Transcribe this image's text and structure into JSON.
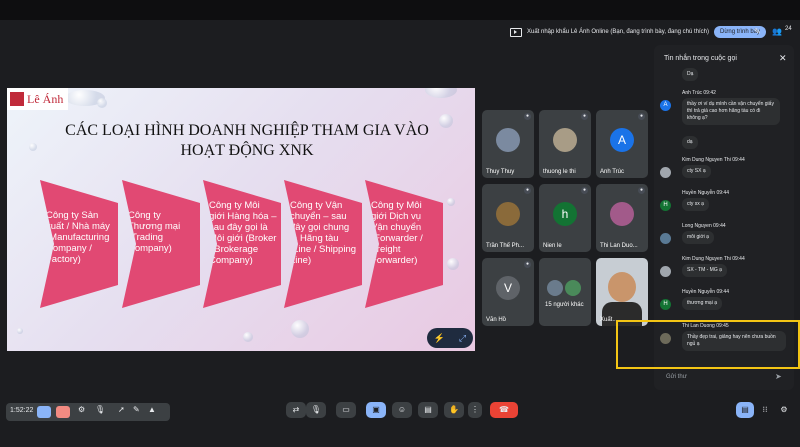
{
  "meeting": {
    "presenting_text": "Xuất nhập khẩu Lê Ánh Online (Bạn, đang trình bày, đang chú thích)",
    "stop_label": "Dừng trình bày",
    "participant_count": "24"
  },
  "slide": {
    "logo_text": "Lê Ánh",
    "title": "CÁC LOẠI HÌNH DOANH NGHIỆP THAM GIA VÀO HOẠT ĐỘNG XNK",
    "items": [
      "Công ty Sản xuất / Nhà máy (Manufacturing Company / Factory)",
      "Công ty Thương mại (Trading Company)",
      "Công ty Môi giới Hàng hóa – sau đây gọi là Môi giới (Broker / Brokerage Company)",
      "Công ty Vận chuyển – sau đây gọi chung là Hãng tàu (Line / Shipping Line)",
      "Công ty Môi giới Dịch vụ Vận chuyển (Forwarder / Freight Forwarder)"
    ]
  },
  "tiles": [
    {
      "name": "Thuy Thuy",
      "bg": "#7b8aa0"
    },
    {
      "name": "thuong le thi",
      "bg": "#a89c86"
    },
    {
      "name": "Anh Trúc",
      "letter": "A",
      "bg": "#1a73e8"
    },
    {
      "name": "Trần Thế Ph...",
      "bg": "#8a6a3a"
    },
    {
      "name": "Nien le",
      "letter": "h",
      "bg": "#137333"
    },
    {
      "name": "Thi Lan Duo...",
      "bg": "#a25a8a"
    },
    {
      "name": "Văn Hồ",
      "letter": "V",
      "bg": "#5f6368"
    },
    {
      "name": "15 người khác",
      "bg": "#3c4043"
    },
    {
      "name": "Xuất...",
      "bg": "#c7cdd3"
    }
  ],
  "chat": {
    "title": "Tin nhắn trong cuộc gọi",
    "input_placeholder": "Gửi thư",
    "messages": [
      {
        "who": "",
        "text": "Dạ"
      },
      {
        "who": "Anh Trúc  09:42",
        "text": "thầy ơi ví dụ mình cần vận chuyển giấy thì trả giá cao hơn hãng tàu có đi không ạ?",
        "letter": "A"
      },
      {
        "who": "",
        "text": "dạ"
      },
      {
        "who": "Kim Dung Nguyen Thi  09:44",
        "text": "cty SX ạ"
      },
      {
        "who": "Huyền Nguyễn  09:44",
        "text": "cty sx ạ",
        "letter": "H"
      },
      {
        "who": "Long Nguyen  09:44",
        "text": "môi giới ạ"
      },
      {
        "who": "Kim Dung Nguyen Thi  09:44",
        "text": "SX - TM - MG ạ"
      },
      {
        "who": "Huyền Nguyễn  09:44",
        "text": "thương mại ạ",
        "letter": "H"
      },
      {
        "who": "Thi Lan Duong  09:45",
        "text": "Thầy đẹp trai, giảng hay nên chưa buồn ngủ ạ"
      }
    ]
  },
  "controls": {
    "time": "1:52:22"
  }
}
